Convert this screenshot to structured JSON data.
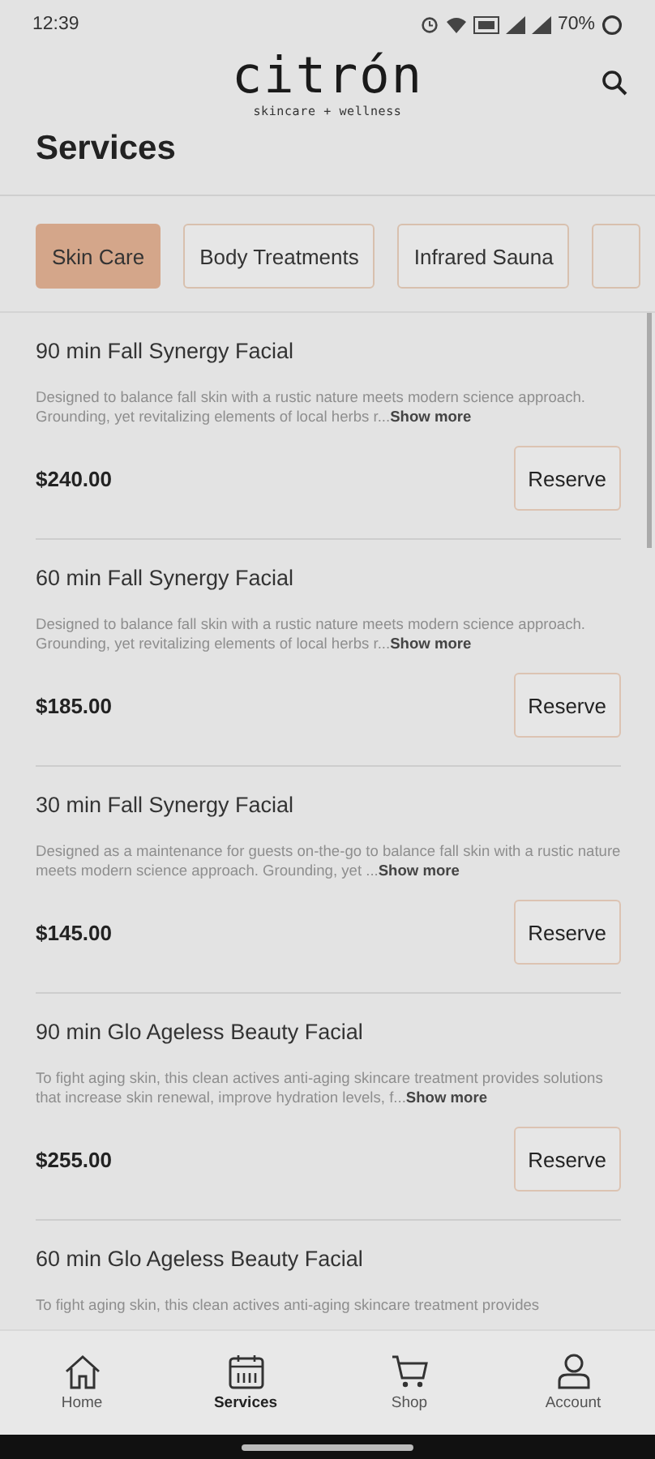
{
  "status_bar": {
    "time": "12:39",
    "battery": "70%"
  },
  "header": {
    "logo": "citrón",
    "tagline": "skincare + wellness"
  },
  "page_title": "Services",
  "categories": [
    {
      "label": "Skin Care",
      "selected": true
    },
    {
      "label": "Body Treatments",
      "selected": false
    },
    {
      "label": "Infrared Sauna",
      "selected": false
    }
  ],
  "services": [
    {
      "title": "90 min  Fall Synergy Facial",
      "description": "Designed to balance fall skin with a rustic nature meets modern science approach. Grounding, yet revitalizing elements of local herbs r...",
      "more_link": "Show more",
      "price": "$240.00",
      "button": "Reserve"
    },
    {
      "title": "60 min  Fall Synergy Facial",
      "description": "Designed to balance fall skin with a rustic nature meets modern science approach. Grounding, yet revitalizing elements of local herbs r...",
      "more_link": "Show more",
      "price": "$185.00",
      "button": "Reserve"
    },
    {
      "title": "30 min  Fall Synergy Facial",
      "description": "Designed as a maintenance for guests on-the-go to balance fall skin with a rustic nature meets modern science approach. Grounding, yet ...",
      "more_link": "Show more",
      "price": "$145.00",
      "button": "Reserve"
    },
    {
      "title": "90 min Glo Ageless Beauty Facial",
      "description": "To fight aging skin, this clean actives anti-aging skincare treatment provides solutions that increase skin renewal, improve hydration levels, f...",
      "more_link": "Show more",
      "price": "$255.00",
      "button": "Reserve"
    },
    {
      "title": "60 min Glo Ageless Beauty Facial",
      "description": "To fight aging skin, this clean actives anti-aging skincare treatment provides"
    }
  ],
  "nav": [
    {
      "label": "Home",
      "kind": "home",
      "selected": false
    },
    {
      "label": "Services",
      "kind": "calendar",
      "selected": true
    },
    {
      "label": "Shop",
      "kind": "cart",
      "selected": false
    },
    {
      "label": "Account",
      "kind": "person",
      "selected": false
    }
  ]
}
